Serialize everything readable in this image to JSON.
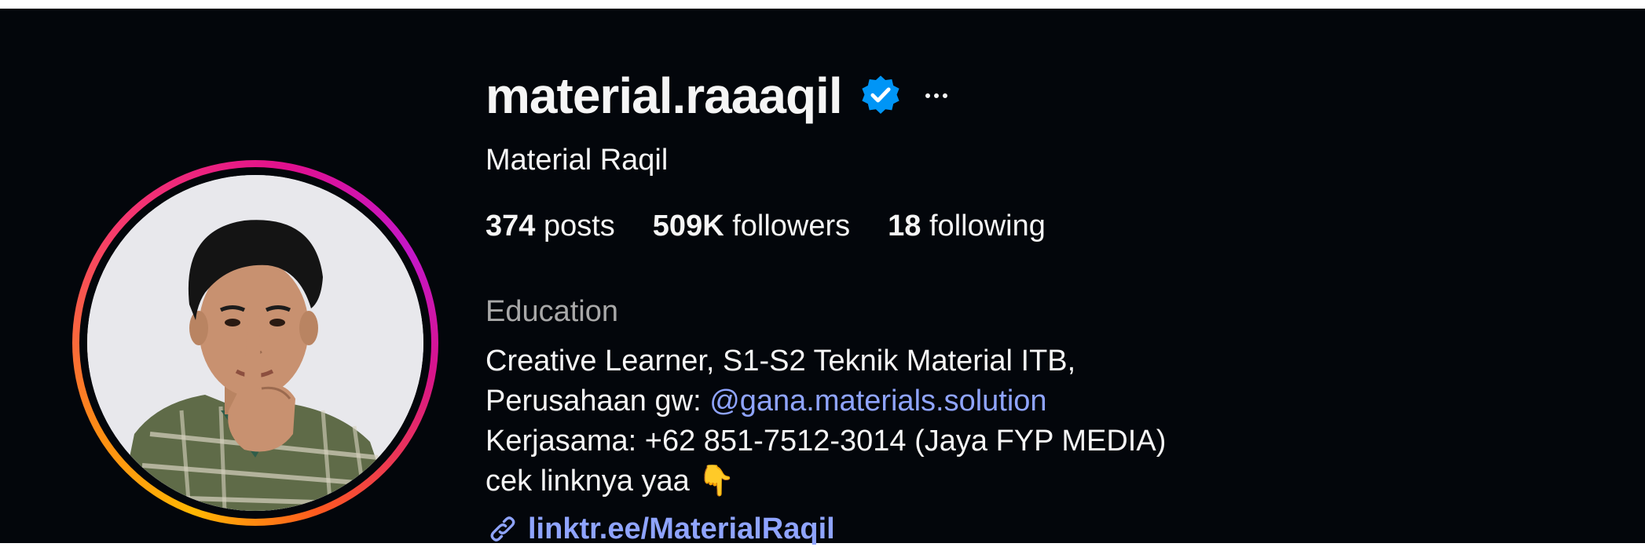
{
  "profile": {
    "username": "material.raaaqil",
    "verified_icon": "verified-badge-icon",
    "more_icon": "ellipsis-icon",
    "full_name": "Material Raqil",
    "stats": {
      "posts_count": "374",
      "posts_label": "posts",
      "followers_count": "509K",
      "followers_label": "followers",
      "following_count": "18",
      "following_label": "following"
    },
    "category": "Education",
    "bio": {
      "line1": "Creative Learner, S1-S2 Teknik Material ITB,",
      "line2_prefix": "Perusahaan gw: ",
      "line2_mention": "@gana.materials.solution",
      "line3": "Kerjasama: +62 851-7512-3014 (Jaya FYP MEDIA)",
      "line4": "cek linknya yaa 👇"
    },
    "link": {
      "icon": "link-icon",
      "text": "linktr.ee/MaterialRaqil"
    }
  },
  "colors": {
    "background": "#03060b",
    "text": "#f5f5f5",
    "secondary_text": "#a8a8a8",
    "link": "#8fa4ff",
    "verified": "#0095f6"
  }
}
